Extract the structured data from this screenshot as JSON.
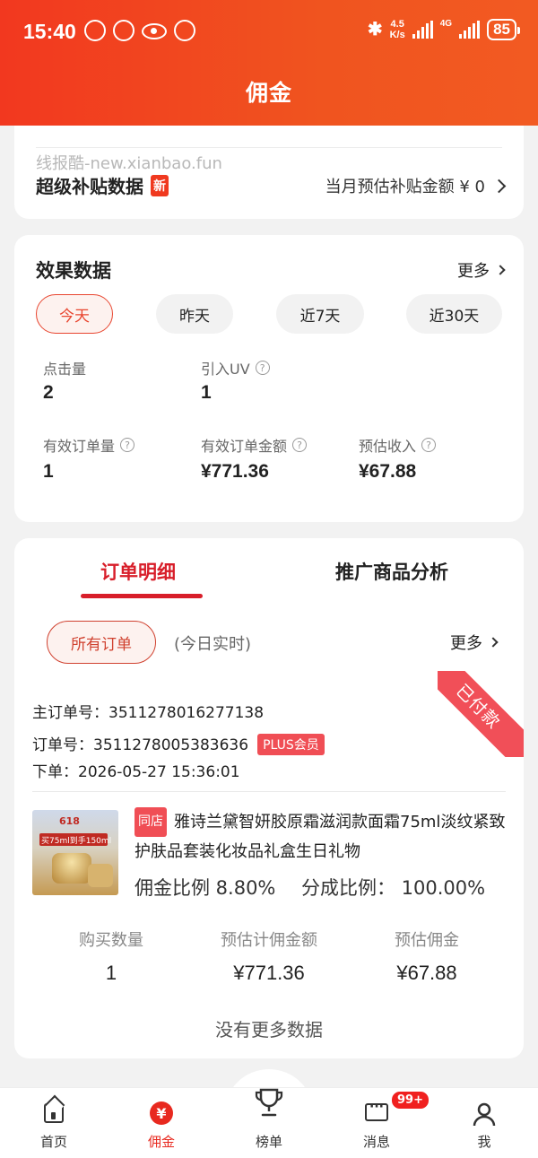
{
  "status_bar": {
    "time": "15:40",
    "net_speed_top": "4.5",
    "net_speed_bottom": "K/s",
    "network": "4G",
    "battery": "85"
  },
  "header": {
    "title": "佣金"
  },
  "subsidy": {
    "watermark": "线报酷-new.xianbao.fun",
    "title": "超级补贴数据",
    "new_badge": "新",
    "amount_text": "当月预估补贴金额 ¥ 0"
  },
  "effect": {
    "title": "效果数据",
    "more": "更多",
    "periods": [
      "今天",
      "昨天",
      "近7天",
      "近30天"
    ],
    "active_period": "今天",
    "metrics": {
      "clicks": {
        "label": "点击量",
        "value": "2"
      },
      "uv": {
        "label": "引入UV",
        "value": "1"
      },
      "orders": {
        "label": "有效订单量",
        "value": "1"
      },
      "order_amount": {
        "label": "有效订单金额",
        "value": "¥771.36"
      },
      "income": {
        "label": "预估收入",
        "value": "¥67.88"
      }
    }
  },
  "orders_section": {
    "tabs": [
      "订单明细",
      "推广商品分析"
    ],
    "active_tab": "订单明细",
    "filter": "所有订单",
    "realtime_note": "(今日实时)",
    "more": "更多",
    "order": {
      "status_ribbon": "已付款",
      "main_order_label": "主订单号：",
      "main_order_no": "3511278016277138",
      "order_label": "订单号：",
      "order_no": "3511278005383636",
      "member_badge": "PLUS会员",
      "placed_label": "下单：",
      "placed_time": "2026-05-27 15:36:01",
      "store_badge": "同店",
      "product_title": "雅诗兰黛智妍胶原霜滋润款面霜75ml淡纹紧致护肤品套装化妆品礼盒生日礼物",
      "commission_ratio": "佣金比例 8.80%",
      "share_ratio": "分成比例：  100.00%",
      "stats": [
        {
          "label": "购买数量",
          "value": "1"
        },
        {
          "label": "预估计佣金额",
          "value": "¥771.36"
        },
        {
          "label": "预估佣金",
          "value": "¥67.88"
        }
      ],
      "product_image_texts": [
        "618",
        "买75ml到手150ml"
      ]
    },
    "no_more": "没有更多数据"
  },
  "tabbar": {
    "items": [
      "首页",
      "佣金",
      "榜单",
      "消息",
      "我"
    ],
    "active": "佣金",
    "message_badge": "99+",
    "yen_symbol": "¥"
  }
}
